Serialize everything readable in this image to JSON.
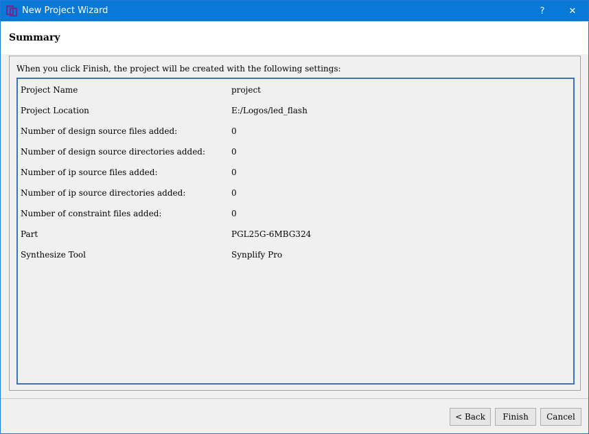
{
  "window": {
    "title": "New Project Wizard",
    "help_label": "?",
    "close_label": "✕",
    "accent_color": "#0a78d7"
  },
  "page": {
    "title": "Summary",
    "intro": "When you click Finish, the project will be created with the following settings:"
  },
  "settings": [
    {
      "label": "Project Name",
      "value": "project"
    },
    {
      "label": "Project Location",
      "value": "E:/Logos/led_flash"
    },
    {
      "label": "Number of design source files added:",
      "value": "0"
    },
    {
      "label": "Number of design source directories added:",
      "value": "0"
    },
    {
      "label": "Number of ip source files added:",
      "value": "0"
    },
    {
      "label": "Number of ip source directories added:",
      "value": "0"
    },
    {
      "label": "Number of constraint files added:",
      "value": "0"
    },
    {
      "label": "Part",
      "value": "PGL25G-6MBG324"
    },
    {
      "label": "Synthesize Tool",
      "value": "Synplify Pro"
    }
  ],
  "buttons": {
    "back": "< Back",
    "finish": "Finish",
    "cancel": "Cancel"
  }
}
